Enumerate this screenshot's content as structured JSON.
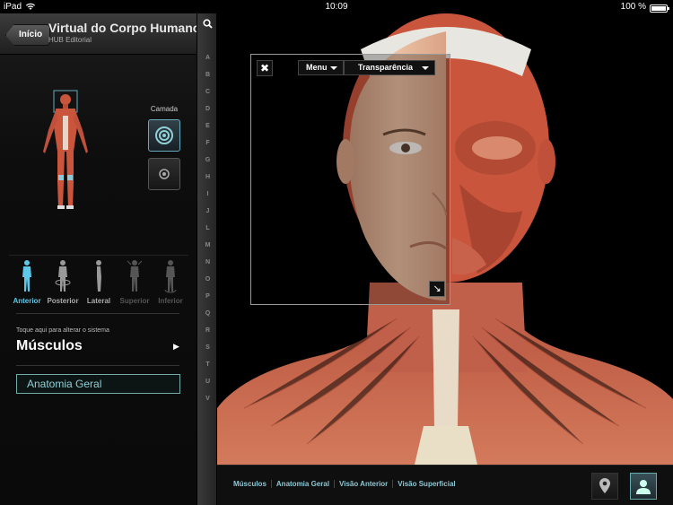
{
  "status_bar": {
    "device": "iPad",
    "time": "10:09",
    "battery": "100 %"
  },
  "header": {
    "back_label": "Início",
    "title": "Virtual do Corpo Humano",
    "subtitle": "HUB Editorial"
  },
  "layer": {
    "label": "Camada"
  },
  "views": [
    {
      "label": "Anterior"
    },
    {
      "label": "Posterior"
    },
    {
      "label": "Lateral"
    },
    {
      "label": "Superior"
    },
    {
      "label": "Inferior"
    }
  ],
  "system": {
    "hint": "Toque aqui para alterar o sistema",
    "name": "Músculos"
  },
  "anatomy_button": "Anatomia Geral",
  "alphabet": [
    "A",
    "B",
    "C",
    "D",
    "E",
    "F",
    "G",
    "H",
    "I",
    "J",
    "L",
    "M",
    "N",
    "O",
    "P",
    "Q",
    "R",
    "S",
    "T",
    "U",
    "V"
  ],
  "overlay": {
    "menu_label": "Menu",
    "transparency_label": "Transparência"
  },
  "breadcrumbs": [
    "Músculos",
    "Anatomia Geral",
    "Visão Anterior",
    "Visão Superficial"
  ],
  "colors": {
    "accent": "#5ec8e8",
    "muscle": "#c8553c",
    "skin": "#e5b596"
  }
}
